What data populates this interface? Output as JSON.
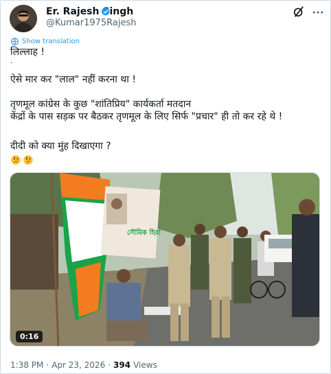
{
  "author": {
    "display_name": "Er. Rajesh Singh",
    "handle": "@Kumar1975Rajesh"
  },
  "actions": {
    "translate_label": "Show translation"
  },
  "tweet": {
    "lines": [
      "लिल्लाह !",
      ".",
      "ऐसे मार कर \"लाल\" नहीं करना था !",
      "तृणमूल कांग्रेस के कुछ \"शांतिप्रिय\" कार्यकर्ता मतदान",
      "केंद्रों के पास सड़क पर बैठकर तृणमूल के लिए सिर्फ \"प्रचार\" ही तो कर रहे थे !",
      "दीदी को क्या मुंह दिखाएगा ?"
    ],
    "emojis": [
      "thinking-face",
      "thinking-face"
    ]
  },
  "media": {
    "duration": "0:16",
    "poster_text": "সৌমিক হিরা"
  },
  "meta": {
    "time": "1:38 PM",
    "date": "Apr 23, 2026",
    "views_count": "394",
    "views_label": "Views"
  },
  "colors": {
    "link": "#1d9bf0",
    "secondary_text": "#536471",
    "tmc_green": "#1aa34a",
    "tmc_saffron": "#f47c20"
  }
}
